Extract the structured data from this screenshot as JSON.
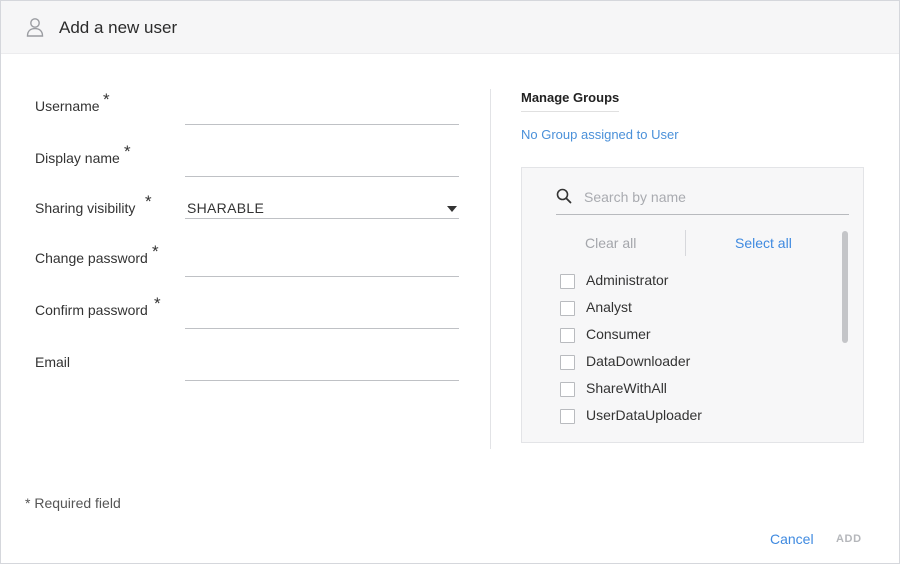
{
  "dialog": {
    "title": "Add a new user",
    "icon": "user-icon"
  },
  "form": {
    "username_label": "Username",
    "display_name_label": "Display name",
    "sharing_visibility_label": "Sharing visibility",
    "sharing_visibility_value": "SHARABLE",
    "change_password_label": "Change password",
    "confirm_password_label": "Confirm password",
    "email_label": "Email",
    "required_marker": "*"
  },
  "groups": {
    "title": "Manage Groups",
    "status": "No Group assigned to User",
    "search_placeholder": "Search by name",
    "clear_all_label": "Clear all",
    "select_all_label": "Select all",
    "items": [
      {
        "label": "Administrator",
        "checked": false
      },
      {
        "label": "Analyst",
        "checked": false
      },
      {
        "label": "Consumer",
        "checked": false
      },
      {
        "label": "DataDownloader",
        "checked": false
      },
      {
        "label": "ShareWithAll",
        "checked": false
      },
      {
        "label": "UserDataUploader",
        "checked": false
      }
    ]
  },
  "footer": {
    "required_note": "* Required field",
    "cancel_label": "Cancel",
    "add_label": "ADD"
  },
  "colors": {
    "link": "#3f8ae0",
    "disabled": "#b5b7bb",
    "header_bg": "#f6f6f7"
  }
}
